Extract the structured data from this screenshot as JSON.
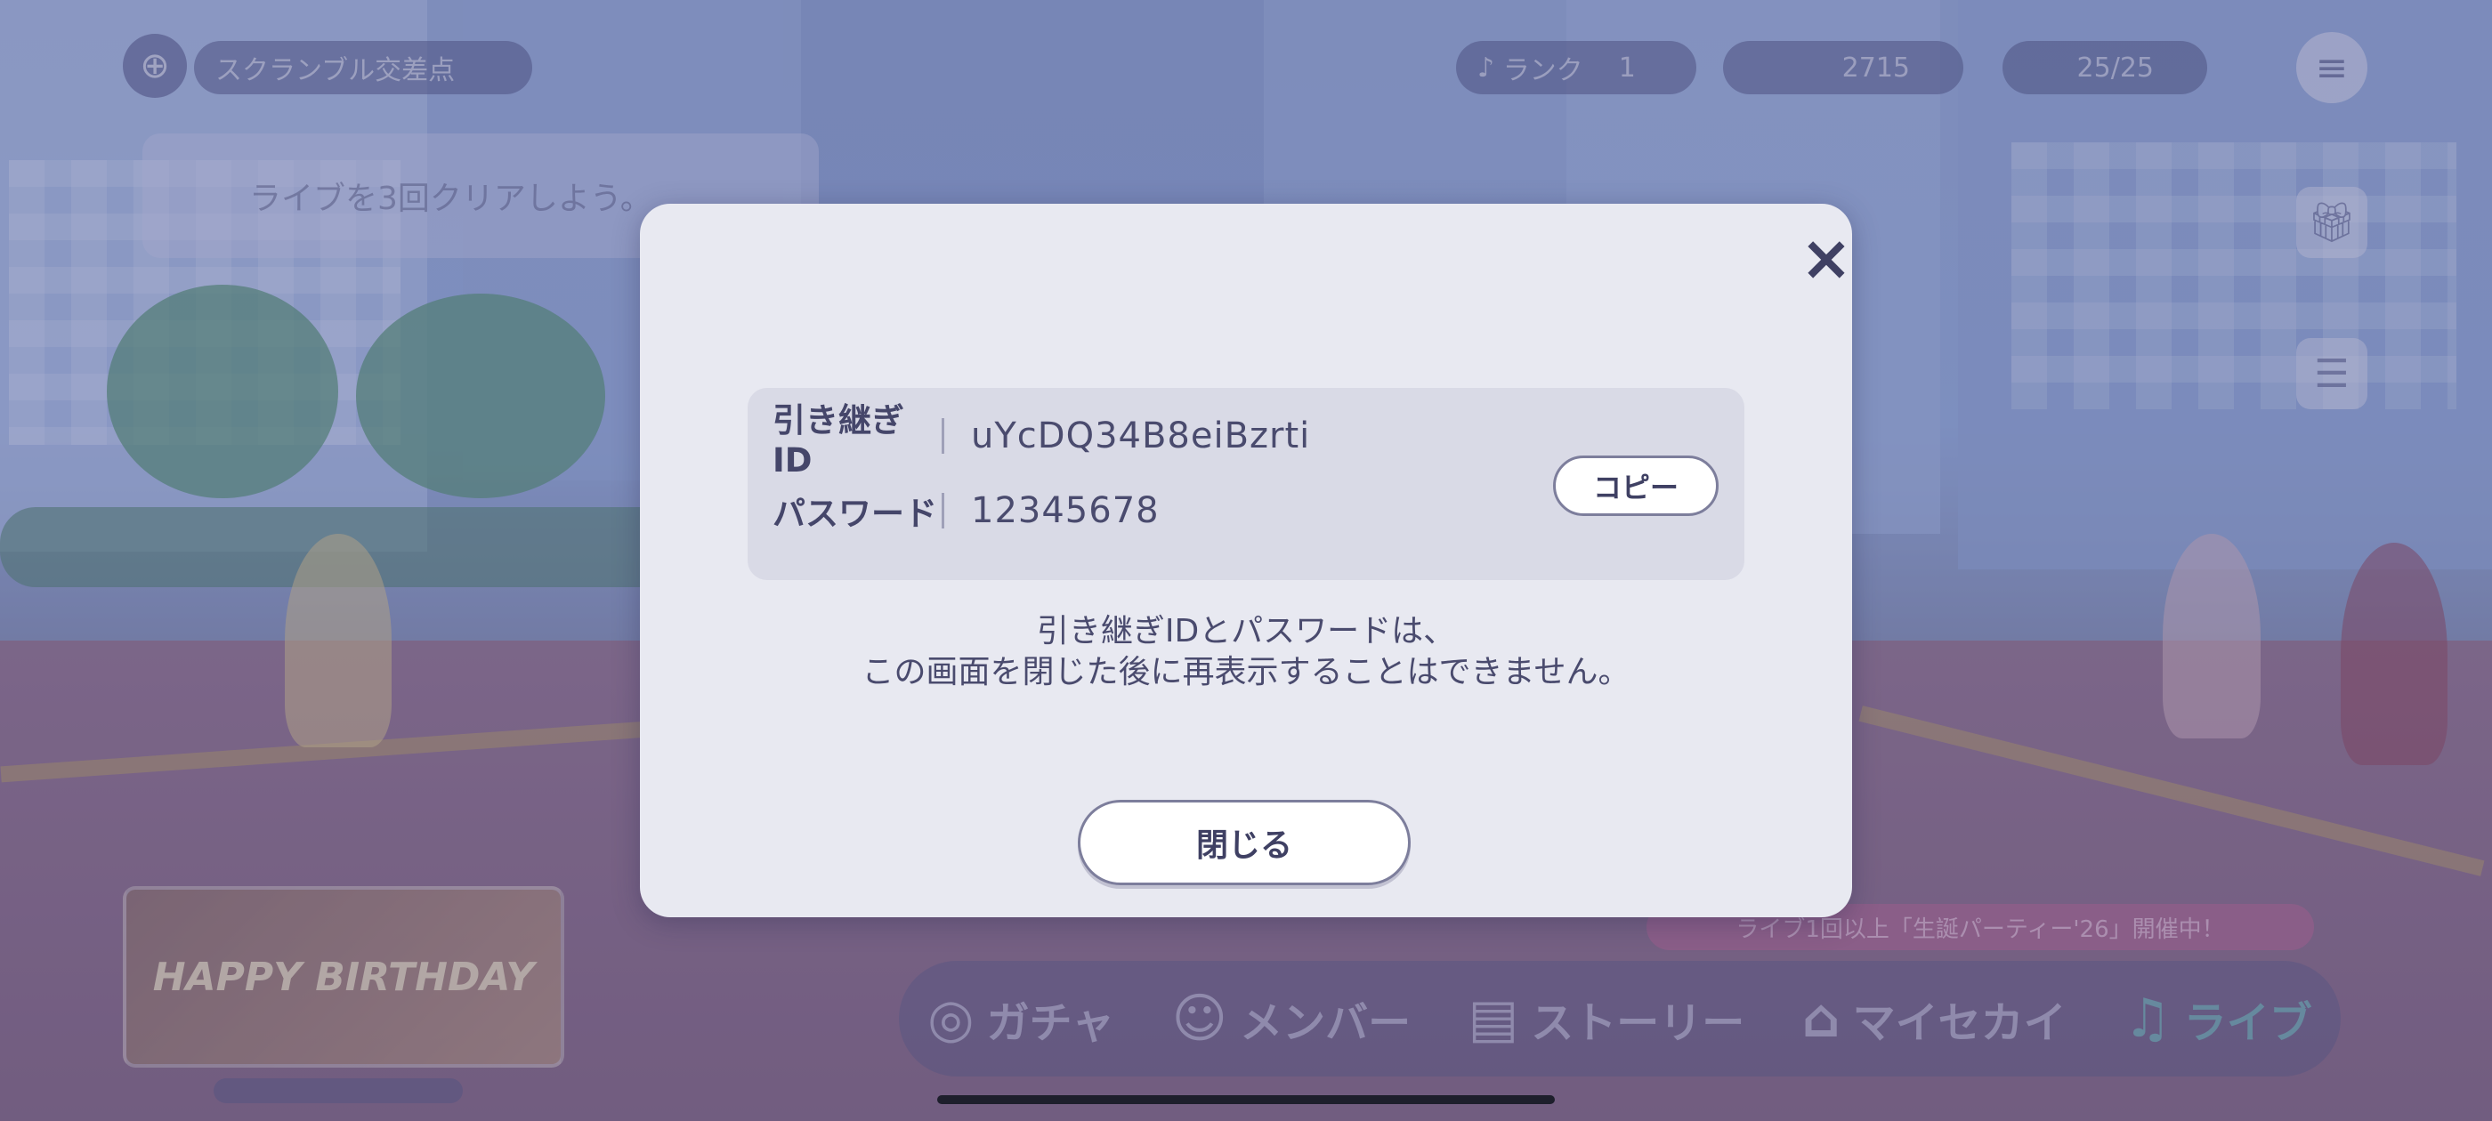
{
  "background": {
    "location_label": "スクランブル交差点",
    "rank_label": "ランク",
    "rank_value": "1",
    "currency_value": "2715",
    "stamina_value": "25/25",
    "mission_text": "ライブを3回クリアしよう。",
    "banner_text": "ライブ1回以上「生誕パーティー'26」開催中！",
    "birthday_text": "HAPPY BIRTHDAY",
    "nav": [
      {
        "label": "ガチャ",
        "icon": "gacha-icon"
      },
      {
        "label": "メンバー",
        "icon": "member-icon"
      },
      {
        "label": "ストーリー",
        "icon": "story-icon"
      },
      {
        "label": "マイセカイ",
        "icon": "home-icon"
      },
      {
        "label": "ライブ",
        "icon": "music-note-icon"
      }
    ]
  },
  "modal": {
    "close_icon": "×",
    "id_label": "引き継ぎID",
    "id_value": "uYcDQ34B8eiBzrti",
    "password_label": "パスワード",
    "password_value": "12345678",
    "copy_label": "コピー",
    "notice_line1": "引き継ぎIDとパスワードは、",
    "notice_line2": "この画面を閉じた後に再表示することはできません。",
    "close_label": "閉じる"
  },
  "colors": {
    "modal_bg": "#e8e9f1",
    "info_box_bg": "#d9dae6",
    "text_primary": "#45466a",
    "button_bg": "#ffffff",
    "overlay": "#5f5f96"
  }
}
